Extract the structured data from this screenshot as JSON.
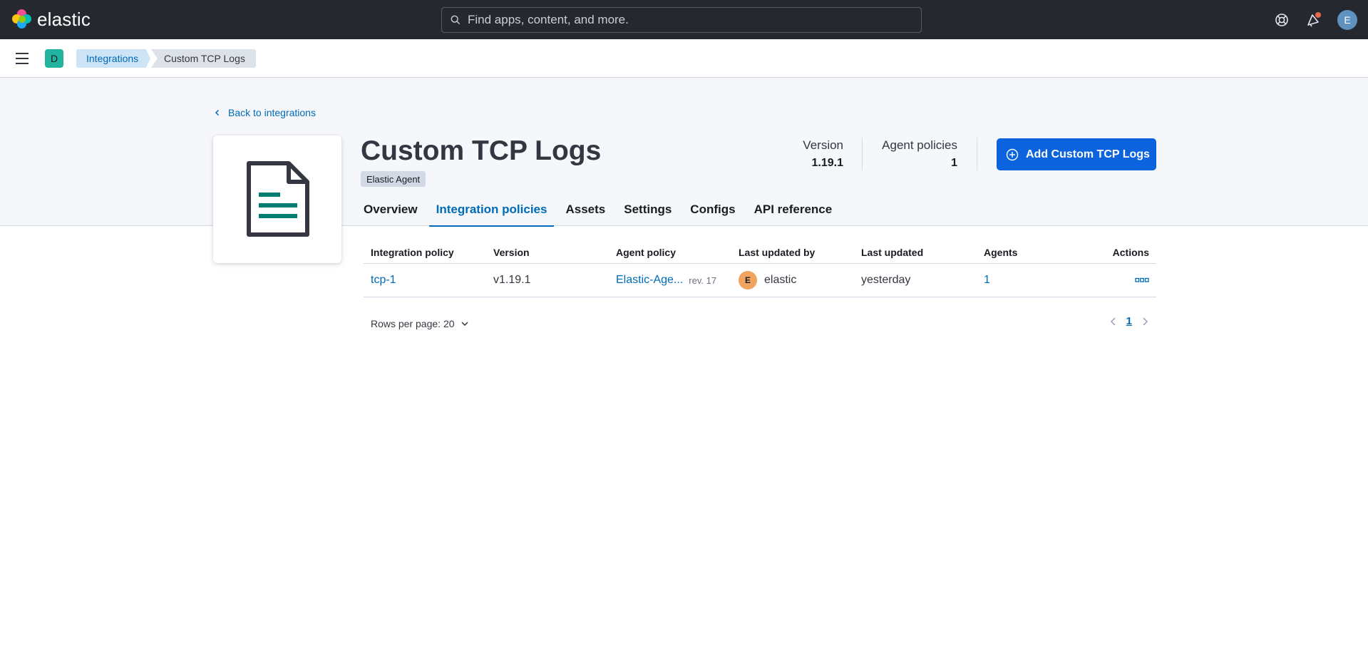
{
  "header": {
    "logo_text": "elastic",
    "search_placeholder": "Find apps, content, and more.",
    "user_initial": "E",
    "colors": {
      "bg": "#25282f",
      "notification_dot": "#e7664c"
    }
  },
  "subheader": {
    "space_initial": "D",
    "breadcrumbs": [
      "Integrations",
      "Custom TCP Logs"
    ]
  },
  "page": {
    "back_label": "Back to integrations",
    "title": "Custom TCP Logs",
    "badge": "Elastic Agent",
    "version_label": "Version",
    "version_value": "1.19.1",
    "agent_policies_label": "Agent policies",
    "agent_policies_value": "1",
    "add_button_label": "Add Custom TCP Logs",
    "accent_color": "#0b64dd"
  },
  "tabs": [
    {
      "label": "Overview",
      "active": false
    },
    {
      "label": "Integration policies",
      "active": true
    },
    {
      "label": "Assets",
      "active": false
    },
    {
      "label": "Settings",
      "active": false
    },
    {
      "label": "Configs",
      "active": false
    },
    {
      "label": "API reference",
      "active": false
    }
  ],
  "table": {
    "columns": [
      "Integration policy",
      "Version",
      "Agent policy",
      "Last updated by",
      "Last updated",
      "Agents",
      "Actions"
    ],
    "rows": [
      {
        "policy": "tcp-1",
        "version": "v1.19.1",
        "agent_policy": "Elastic-Age...",
        "revision": "rev. 17",
        "updated_by_initial": "E",
        "updated_by": "elastic",
        "last_updated": "yesterday",
        "agents": "1"
      }
    ]
  },
  "pagination": {
    "rows_per_page": "Rows per page: 20",
    "current_page": "1"
  }
}
